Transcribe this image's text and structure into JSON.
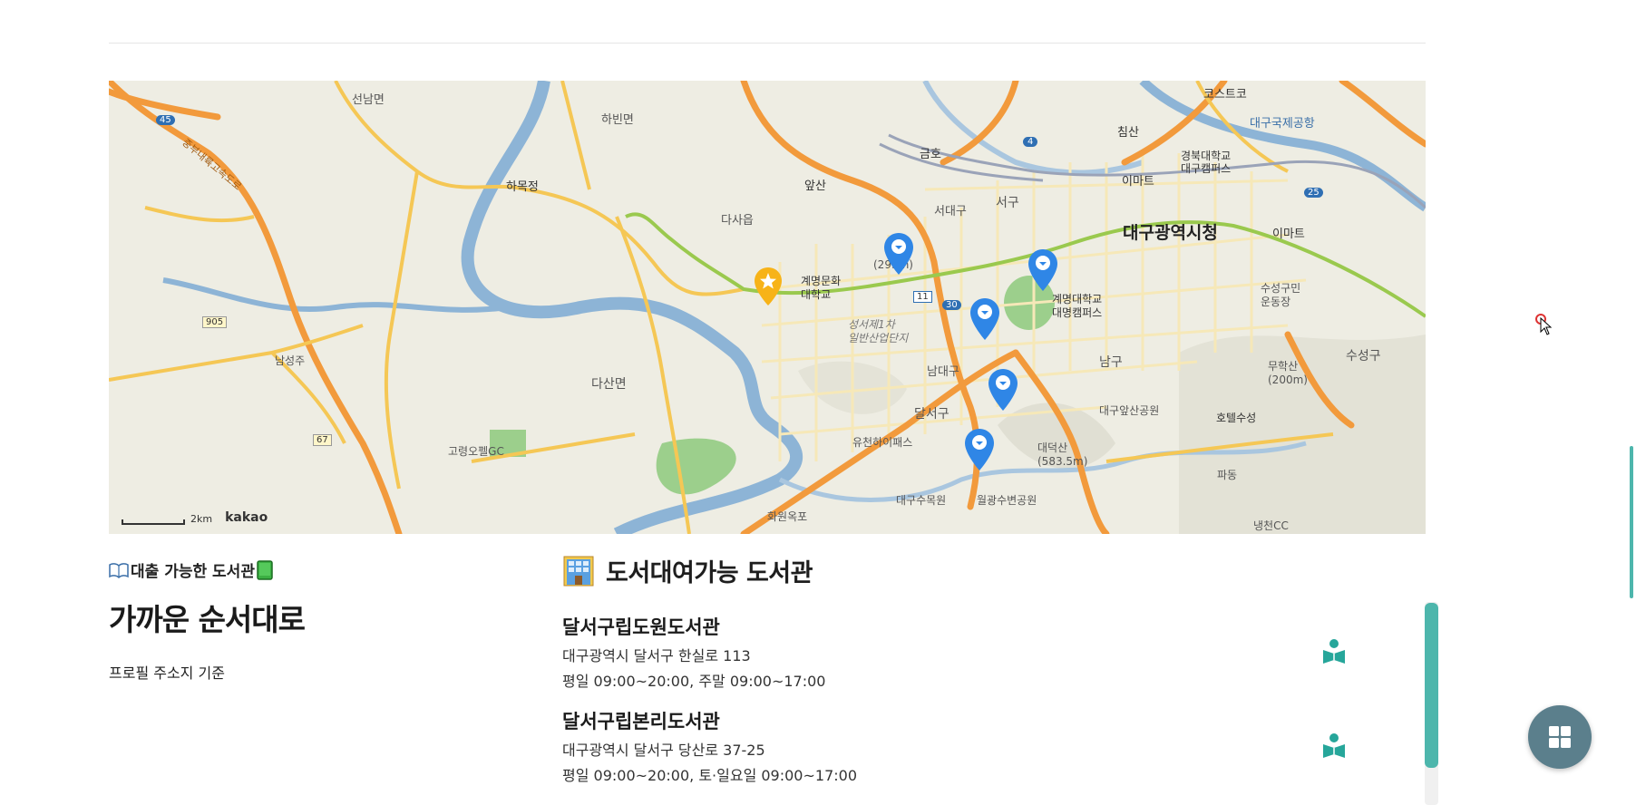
{
  "map": {
    "labels": {
      "seonnam": "선남면",
      "habin": "하빈면",
      "hamokjeong": "하목정",
      "dasa": "다사읍",
      "apsan": "앞산",
      "geumho": "금호",
      "seodaegu": "서대구",
      "seogu": "서구",
      "chimsan": "침산",
      "costco": "코스트코",
      "airport": "대구국제공항",
      "knu": "경북대학교\n대구캠퍼스",
      "emart1": "이마트",
      "emart2": "이마트",
      "cityhall": "대구광역시청",
      "suseong_stadium": "수성구민\n운동장",
      "suseonggu": "수성구",
      "muhaksan": "무학산\n(200m)",
      "namgu": "남구",
      "keimyung_daemyung": "계명대학교\n대명캠퍼스",
      "keimyung_munhwa": "계명문화\n대학교",
      "industrial": "성서제1차\n일반산업단지",
      "namdaegu": "남대구",
      "dalseogu": "달서구",
      "yuchun": "유천하이패스",
      "daegu_apsan_park": "대구앞산공원",
      "hotel": "호텔수성",
      "daedeoksan": "대덕산\n(583.5m)",
      "pado": "파동",
      "daegu_arboretum": "대구수목원",
      "wolgwang": "월광수변공원",
      "hwawon": "화원옥포",
      "naengcheon": "냉천CC",
      "dasan": "다산면",
      "goryeong": "고령오펠GC",
      "namseongju": "남성주",
      "sta_293": "(293m)",
      "highway_name": "중부내륙고속도로"
    },
    "route_numbers": [
      "45",
      "905",
      "67",
      "4",
      "25",
      "11",
      "30"
    ],
    "scale_text": "2km",
    "brand": "kakao",
    "pin_color": "#2f86e6",
    "star_pin_color": "#f7b318"
  },
  "left": {
    "subtitle": "대출 가능한 도서관",
    "title": "가까운 순서대로",
    "note": "프로필 주소지 기준"
  },
  "libraries": {
    "heading": "도서대여가능 도서관",
    "icon_color": "#26a69a",
    "items": [
      {
        "name": "달서구립도원도서관",
        "address": "대구광역시 달서구 한실로 113",
        "hours": "평일 09:00~20:00, 주말 09:00~17:00"
      },
      {
        "name": "달서구립본리도서관",
        "address": "대구광역시 달서구 당산로 37-25",
        "hours": "평일 09:00~20:00, 토·일요일 09:00~17:00"
      }
    ]
  },
  "scrollbar": {
    "color": "#4db6ac"
  },
  "fab": {
    "icon": "grid-icon",
    "color": "#5b7f8c"
  }
}
